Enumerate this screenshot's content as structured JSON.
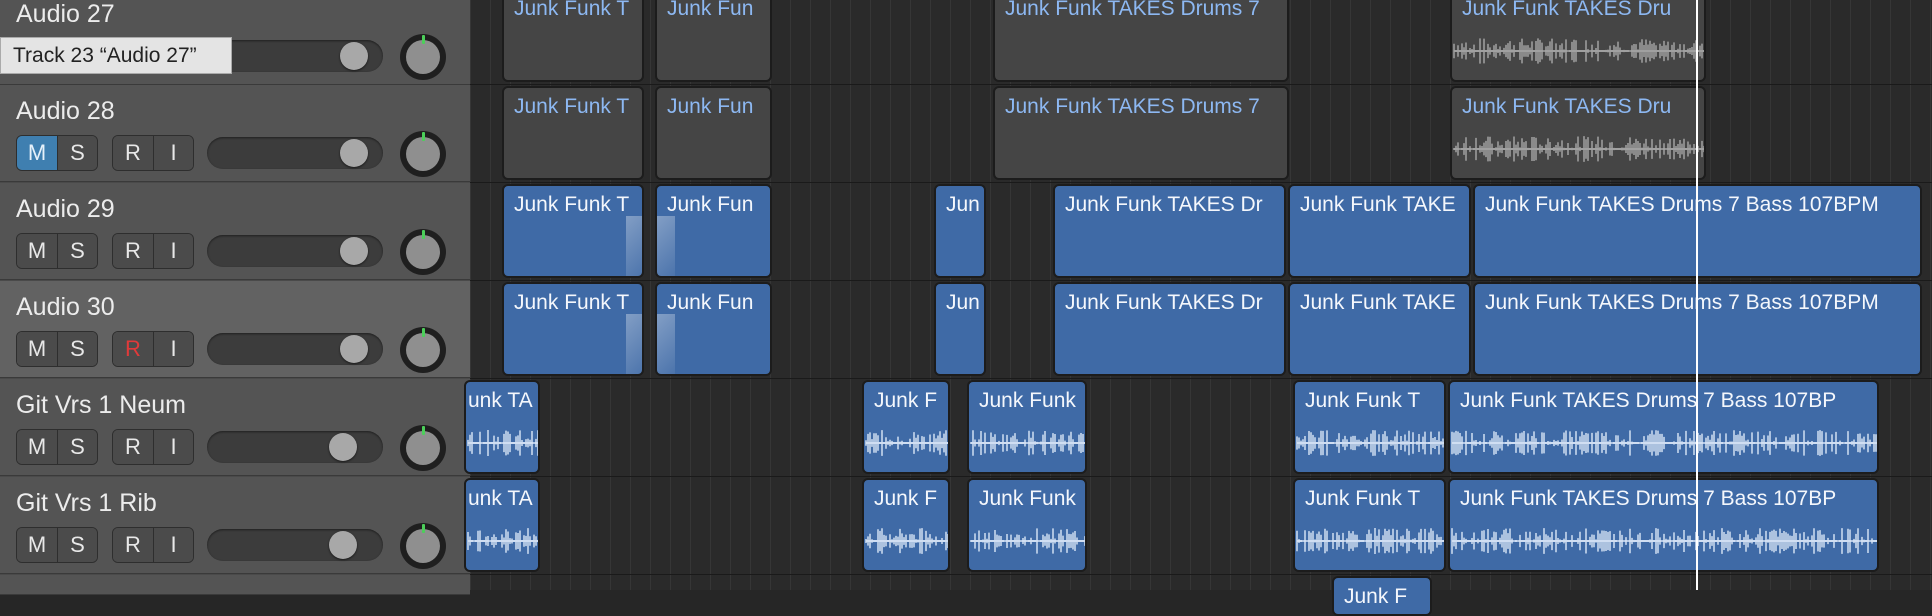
{
  "tooltip": "Track 23 “Audio 27”",
  "track_headers": [
    {
      "name": "Audio 27",
      "mute": "M",
      "solo": "S",
      "rec": "R",
      "input": "I",
      "mute_active": false,
      "rec_active": false,
      "volume_fraction": 0.78
    },
    {
      "name": "Audio 28",
      "mute": "M",
      "solo": "S",
      "rec": "R",
      "input": "I",
      "mute_active": true,
      "rec_active": false,
      "volume_fraction": 0.78
    },
    {
      "name": "Audio 29",
      "mute": "M",
      "solo": "S",
      "rec": "R",
      "input": "I",
      "mute_active": false,
      "rec_active": false,
      "volume_fraction": 0.78
    },
    {
      "name": "Audio 30",
      "mute": "M",
      "solo": "S",
      "rec": "R",
      "input": "I",
      "mute_active": false,
      "rec_active": true,
      "volume_fraction": 0.78,
      "selected": true
    },
    {
      "name": "Git Vrs 1 Neum",
      "mute": "M",
      "solo": "S",
      "rec": "R",
      "input": "I",
      "mute_active": false,
      "rec_active": false,
      "volume_fraction": 0.72
    },
    {
      "name": "Git Vrs 1 Rib",
      "mute": "M",
      "solo": "S",
      "rec": "R",
      "input": "I",
      "mute_active": false,
      "rec_active": false,
      "volume_fraction": 0.72
    }
  ],
  "region_titles": {
    "a27": [
      "Junk Funk T",
      "Junk Fun",
      "Junk Funk TAKES Drums 7",
      "Junk Funk TAKES Dru"
    ],
    "a28": [
      "Junk Funk T",
      "Junk Fun",
      "Junk Funk TAKES Drums 7",
      "Junk Funk TAKES Dru"
    ],
    "a29": [
      "Junk Funk T",
      "Junk Fun",
      "Jun",
      "Junk Funk TAKES Dr",
      "Junk Funk TAKE",
      "Junk Funk TAKES Drums 7 Bass 107BPM"
    ],
    "a30": [
      "Junk Funk T",
      "Junk Fun",
      "Jun",
      "Junk Funk TAKES Dr",
      "Junk Funk TAKE",
      "Junk Funk TAKES Drums 7 Bass 107BPM"
    ],
    "neum": [
      "unk TA",
      "Junk F",
      "Junk Funk",
      "Junk Funk T",
      "Junk Funk TAKES Drums 7 Bass 107BP"
    ],
    "rib": [
      "unk TA",
      "Junk F",
      "Junk Funk",
      "Junk Funk T",
      "Junk Funk TAKES Drums 7 Bass 107BP"
    ],
    "next": [
      "Junk F"
    ]
  },
  "colors": {
    "region_blue": "#3f6aa6",
    "region_grey": "#454545",
    "grey_title": "#8db8f2",
    "mute_active": "#3f7fb0",
    "rec_active": "#e03a3a",
    "pan_indicator": "#4ccf5a",
    "playhead": "#ffffff"
  }
}
